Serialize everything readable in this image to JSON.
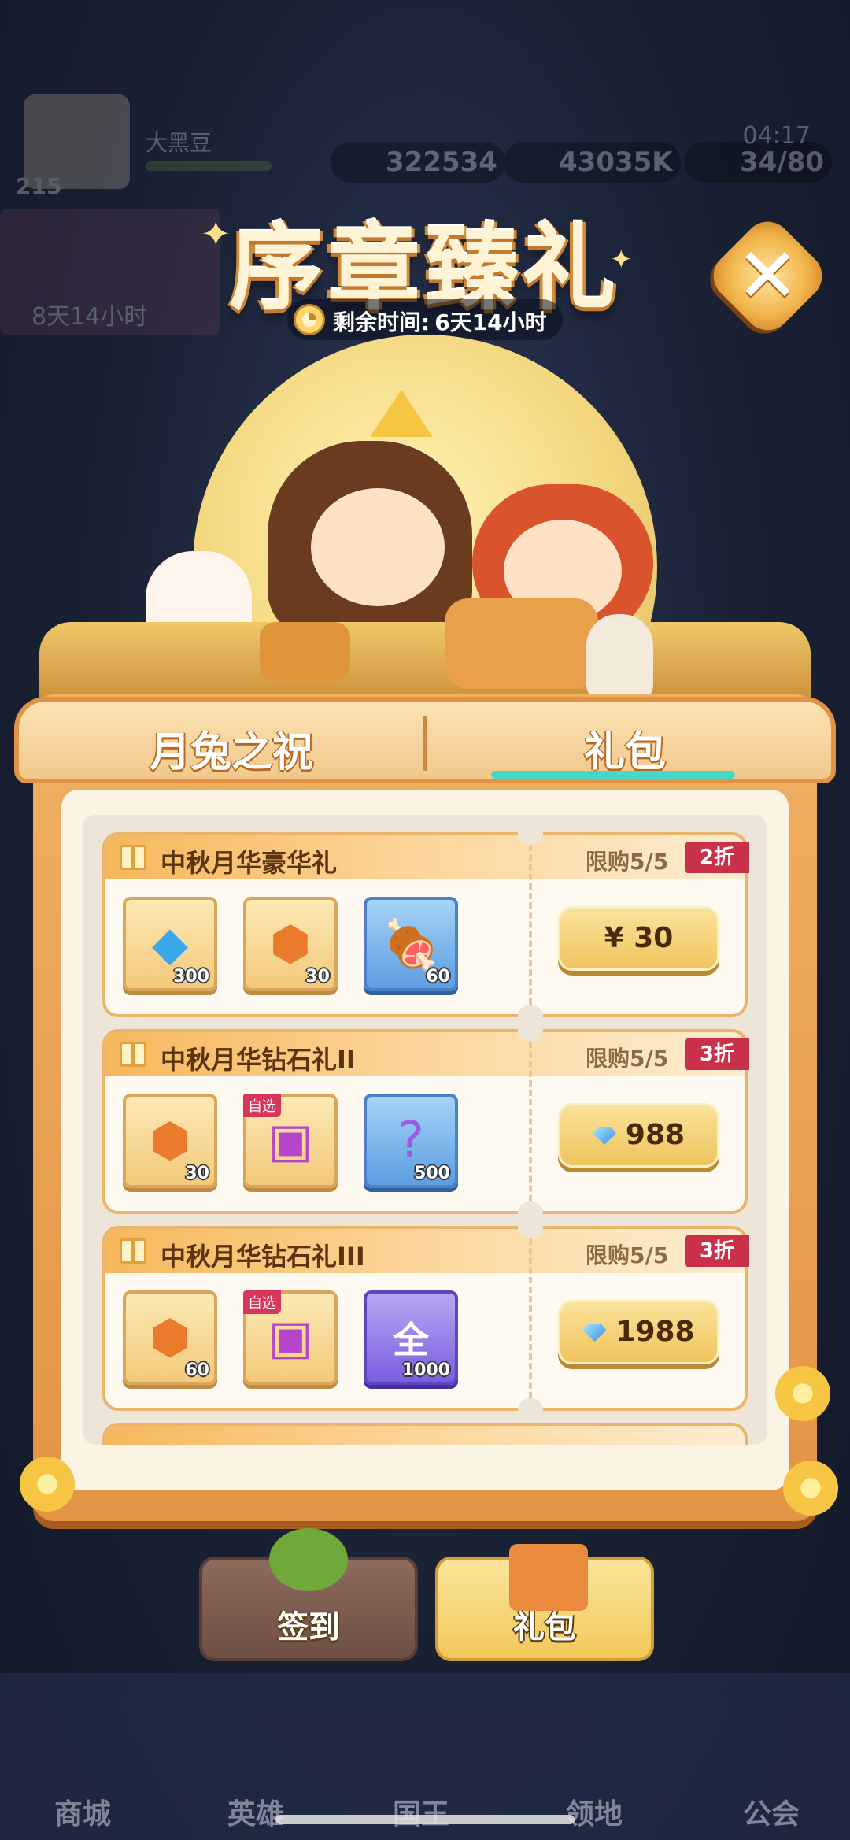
{
  "hud": {
    "player_name": "大黑豆",
    "level": "215",
    "gems": "322534",
    "gold": "43035K",
    "stamina": "34/80",
    "clock": "04:17",
    "event_timer": "8天14小时"
  },
  "event": {
    "title": "序章臻礼",
    "timer_label": "剩余时间:",
    "timer_value": "6天14小时"
  },
  "tabs": {
    "left": "月兔之祝",
    "right": "礼包",
    "active": "right"
  },
  "packs": [
    {
      "title": "中秋月华豪华礼",
      "limit": "限购5/5",
      "discount": "2折",
      "price": "¥ 30",
      "price_type": "currency",
      "items": [
        {
          "icon": "diamond-icon",
          "qty": "300",
          "style": "gold"
        },
        {
          "icon": "orange-crystal-icon",
          "qty": "30",
          "style": "gold"
        },
        {
          "icon": "meat-icon",
          "qty": "60",
          "style": "blue"
        }
      ]
    },
    {
      "title": "中秋月华钻石礼II",
      "limit": "限购5/5",
      "discount": "3折",
      "price": "988",
      "price_type": "gem",
      "items": [
        {
          "icon": "orange-crystal-icon",
          "qty": "30",
          "style": "gold"
        },
        {
          "icon": "mystery-chest-icon",
          "qty": "",
          "tag": "自选",
          "style": "gold"
        },
        {
          "icon": "question-orb-icon",
          "qty": "500",
          "style": "blue"
        }
      ]
    },
    {
      "title": "中秋月华钻石礼III",
      "limit": "限购5/5",
      "discount": "3折",
      "price": "1988",
      "price_type": "gem",
      "items": [
        {
          "icon": "orange-crystal-icon",
          "qty": "60",
          "style": "gold"
        },
        {
          "icon": "mystery-chest-icon",
          "qty": "",
          "tag": "自选",
          "style": "gold"
        },
        {
          "icon": "all-orb-icon",
          "qty": "1000",
          "style": "purple",
          "glyph": "全"
        }
      ]
    }
  ],
  "bottom_buttons": {
    "signin": "签到",
    "gift": "礼包"
  },
  "bottom_nav": [
    "商城",
    "英雄",
    "国王",
    "领地",
    "公会"
  ],
  "colors": {
    "accent_teal": "#47d7c9",
    "discount_red": "#c9314a",
    "panel_orange": "#e39445"
  }
}
